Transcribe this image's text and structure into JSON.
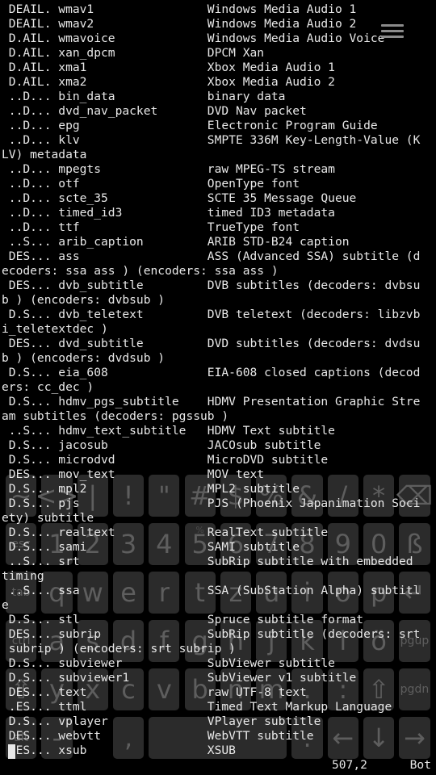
{
  "terminal": {
    "lines": [
      " DEAIL. wmav1                Windows Media Audio 1",
      " DEAIL. wmav2                Windows Media Audio 2",
      " D.AIL. wmavoice             Windows Media Audio Voice",
      " D.AIL. xan_dpcm             DPCM Xan",
      " D.AIL. xma1                 Xbox Media Audio 1",
      " D.AIL. xma2                 Xbox Media Audio 2",
      " ..D... bin_data             binary data",
      " ..D... dvd_nav_packet       DVD Nav packet",
      " ..D... epg                  Electronic Program Guide",
      " ..D... klv                  SMPTE 336M Key-Length-Value (K",
      "LV) metadata",
      " ..D... mpegts               raw MPEG-TS stream",
      " ..D... otf                  OpenType font",
      " ..D... scte_35              SCTE 35 Message Queue",
      " ..D... timed_id3            timed ID3 metadata",
      " ..D... ttf                  TrueType font",
      " ..S... arib_caption         ARIB STD-B24 caption",
      " DES... ass                  ASS (Advanced SSA) subtitle (d",
      "ecoders: ssa ass ) (encoders: ssa ass )",
      " DES... dvb_subtitle         DVB subtitles (decoders: dvbsu",
      "b ) (encoders: dvbsub )",
      " D.S... dvb_teletext         DVB teletext (decoders: libzvb",
      "i_teletextdec )",
      " DES... dvd_subtitle         DVD subtitles (decoders: dvdsu",
      "b ) (encoders: dvdsub )",
      " D.S... eia_608              EIA-608 closed captions (decod",
      "ers: cc_dec )",
      " D.S... hdmv_pgs_subtitle    HDMV Presentation Graphic Stre",
      "am subtitles (decoders: pgssub )",
      " ..S... hdmv_text_subtitle   HDMV Text subtitle",
      " D.S... jacosub              JACOsub subtitle",
      " D.S... microdvd             MicroDVD subtitle",
      " DES... mov_text             MOV text",
      " D.S... mpl2                 MPL2 subtitle",
      " D.S... pjs                  PJS (Phoenix Japanimation Soci",
      "ety) subtitle",
      " D.S... realtext             RealText subtitle",
      " D.S... sami                 SAMI subtitle",
      " ..S... srt                  SubRip subtitle with embedded ",
      "timing",
      " ..S... ssa                  SSA (SubStation Alpha) subtitl",
      "e",
      " D.S... stl                  Spruce subtitle format",
      " DES... subrip               SubRip subtitle (decoders: srt",
      " subrip ) (encoders: srt subrip )",
      " D.S... subviewer            SubViewer subtitle",
      " D.S... subviewer1           SubViewer v1 subtitle",
      " DES... text                 raw UTF-8 text",
      " .ES... ttml                 Timed Text Markup Language",
      " D.S... vplayer              VPlayer subtitle",
      " DES... webvtt               WebVTT subtitle",
      " DES... xsub                 XSUB"
    ],
    "position": "507,2",
    "scroll": "Bot"
  },
  "keyboard": {
    "keys": [
      {
        "label": "~",
        "hint": "`",
        "r": 0,
        "c": 0
      },
      {
        "label": "<>",
        "hint": "",
        "r": 0,
        "c": 1
      },
      {
        "label": "|",
        "hint": "",
        "r": 0,
        "c": 2
      },
      {
        "label": "!",
        "hint": "",
        "r": 0,
        "c": 3
      },
      {
        "label": "\"",
        "hint": "",
        "r": 0,
        "c": 4
      },
      {
        "label": "#",
        "hint": "",
        "r": 0,
        "c": 5
      },
      {
        "label": "$",
        "hint": "",
        "r": 0,
        "c": 6
      },
      {
        "label": "%",
        "hint": "",
        "r": 0,
        "c": 7
      },
      {
        "label": "&",
        "hint": "",
        "r": 0,
        "c": 8
      },
      {
        "label": "/",
        "hint": "",
        "r": 0,
        "c": 9
      },
      {
        "label": "*",
        "hint": "",
        "r": 0,
        "c": 10
      },
      {
        "label": "⌫",
        "hint": "",
        "r": 0,
        "c": 11
      },
      {
        "label": "esc",
        "hint": "",
        "r": 1,
        "c": 0
      },
      {
        "label": "1",
        "hint": "",
        "r": 1,
        "c": 1
      },
      {
        "label": "2",
        "hint": "",
        "r": 1,
        "c": 2
      },
      {
        "label": "3",
        "hint": "",
        "r": 1,
        "c": 3
      },
      {
        "label": "4",
        "hint": "",
        "r": 1,
        "c": 4
      },
      {
        "label": "5",
        "hint": "%",
        "r": 1,
        "c": 5
      },
      {
        "label": "6",
        "hint": "",
        "r": 1,
        "c": 6
      },
      {
        "label": "7",
        "hint": "",
        "r": 1,
        "c": 7
      },
      {
        "label": "8",
        "hint": "",
        "r": 1,
        "c": 8
      },
      {
        "label": "9",
        "hint": "",
        "r": 1,
        "c": 9
      },
      {
        "label": "0",
        "hint": "",
        "r": 1,
        "c": 10
      },
      {
        "label": "ß",
        "hint": "",
        "r": 1,
        "c": 11
      },
      {
        "label": "tab",
        "hint": "",
        "r": 2,
        "c": 0
      },
      {
        "label": "q",
        "hint": "",
        "r": 2,
        "c": 1
      },
      {
        "label": "w",
        "hint": "",
        "r": 2,
        "c": 2
      },
      {
        "label": "e",
        "hint": "",
        "r": 2,
        "c": 3
      },
      {
        "label": "r",
        "hint": "",
        "r": 2,
        "c": 4
      },
      {
        "label": "t",
        "hint": "",
        "r": 2,
        "c": 5
      },
      {
        "label": "z",
        "hint": "",
        "r": 2,
        "c": 6
      },
      {
        "label": "u",
        "hint": "",
        "r": 2,
        "c": 7
      },
      {
        "label": "i",
        "hint": "",
        "r": 2,
        "c": 8
      },
      {
        "label": "o",
        "hint": "",
        "r": 2,
        "c": 9
      },
      {
        "label": "p",
        "hint": "",
        "r": 2,
        "c": 10
      },
      {
        "label": "↵",
        "hint": "",
        "r": 2,
        "c": 11
      },
      {
        "label": "ctrl",
        "hint": "",
        "r": 3,
        "c": 0
      },
      {
        "label": "a",
        "hint": "",
        "r": 3,
        "c": 1
      },
      {
        "label": "s",
        "hint": "",
        "r": 3,
        "c": 2
      },
      {
        "label": "d",
        "hint": "",
        "r": 3,
        "c": 3
      },
      {
        "label": "f",
        "hint": "",
        "r": 3,
        "c": 4
      },
      {
        "label": "g",
        "hint": "",
        "r": 3,
        "c": 5
      },
      {
        "label": "h",
        "hint": "",
        "r": 3,
        "c": 6
      },
      {
        "label": "j",
        "hint": "",
        "r": 3,
        "c": 7
      },
      {
        "label": "k",
        "hint": "",
        "r": 3,
        "c": 8
      },
      {
        "label": "l",
        "hint": "",
        "r": 3,
        "c": 9
      },
      {
        "label": "ö",
        "hint": "",
        "r": 3,
        "c": 10
      },
      {
        "label": "pgup",
        "hint": "",
        "r": 3,
        "c": 11
      },
      {
        "label": "⇧",
        "hint": "",
        "r": 4,
        "c": 0
      },
      {
        "label": "y",
        "hint": "",
        "r": 4,
        "c": 1
      },
      {
        "label": "x",
        "hint": "",
        "r": 4,
        "c": 2
      },
      {
        "label": "c",
        "hint": "",
        "r": 4,
        "c": 3
      },
      {
        "label": "v",
        "hint": "",
        "r": 4,
        "c": 4
      },
      {
        "label": "b",
        "hint": "",
        "r": 4,
        "c": 5
      },
      {
        "label": "n",
        "hint": "",
        "r": 4,
        "c": 6
      },
      {
        "label": "m",
        "hint": "",
        "r": 4,
        "c": 7
      },
      {
        "label": ".",
        "hint": "",
        "r": 4,
        "c": 8
      },
      {
        "label": ":",
        "hint": "",
        "r": 4,
        "c": 9
      },
      {
        "label": "⇧",
        "hint": "",
        "r": 4,
        "c": 10
      },
      {
        "label": "pgdn",
        "hint": "",
        "r": 4,
        "c": 11
      },
      {
        "label": "alt",
        "hint": "",
        "r": 5,
        "c": 0
      },
      {
        "label": "-",
        "hint": "",
        "r": 5,
        "c": 1
      },
      {
        "label": ",",
        "hint": "",
        "r": 5,
        "c": 3
      },
      {
        "label": "",
        "hint": "",
        "r": 5,
        "c": 4,
        "span": 4
      },
      {
        "label": ".",
        "hint": "",
        "r": 5,
        "c": 8
      },
      {
        "label": "←",
        "hint": "",
        "r": 5,
        "c": 9
      },
      {
        "label": "↓",
        "hint": "",
        "r": 5,
        "c": 10
      },
      {
        "label": "→",
        "hint": "",
        "r": 5,
        "c": 11
      }
    ]
  },
  "colors": {
    "text": "#e8e8e8",
    "background": "#000000",
    "key_background": "#2b2b2b",
    "key_label": "#5e5e5e"
  },
  "icons": {
    "menu": "hamburger-menu-icon"
  }
}
